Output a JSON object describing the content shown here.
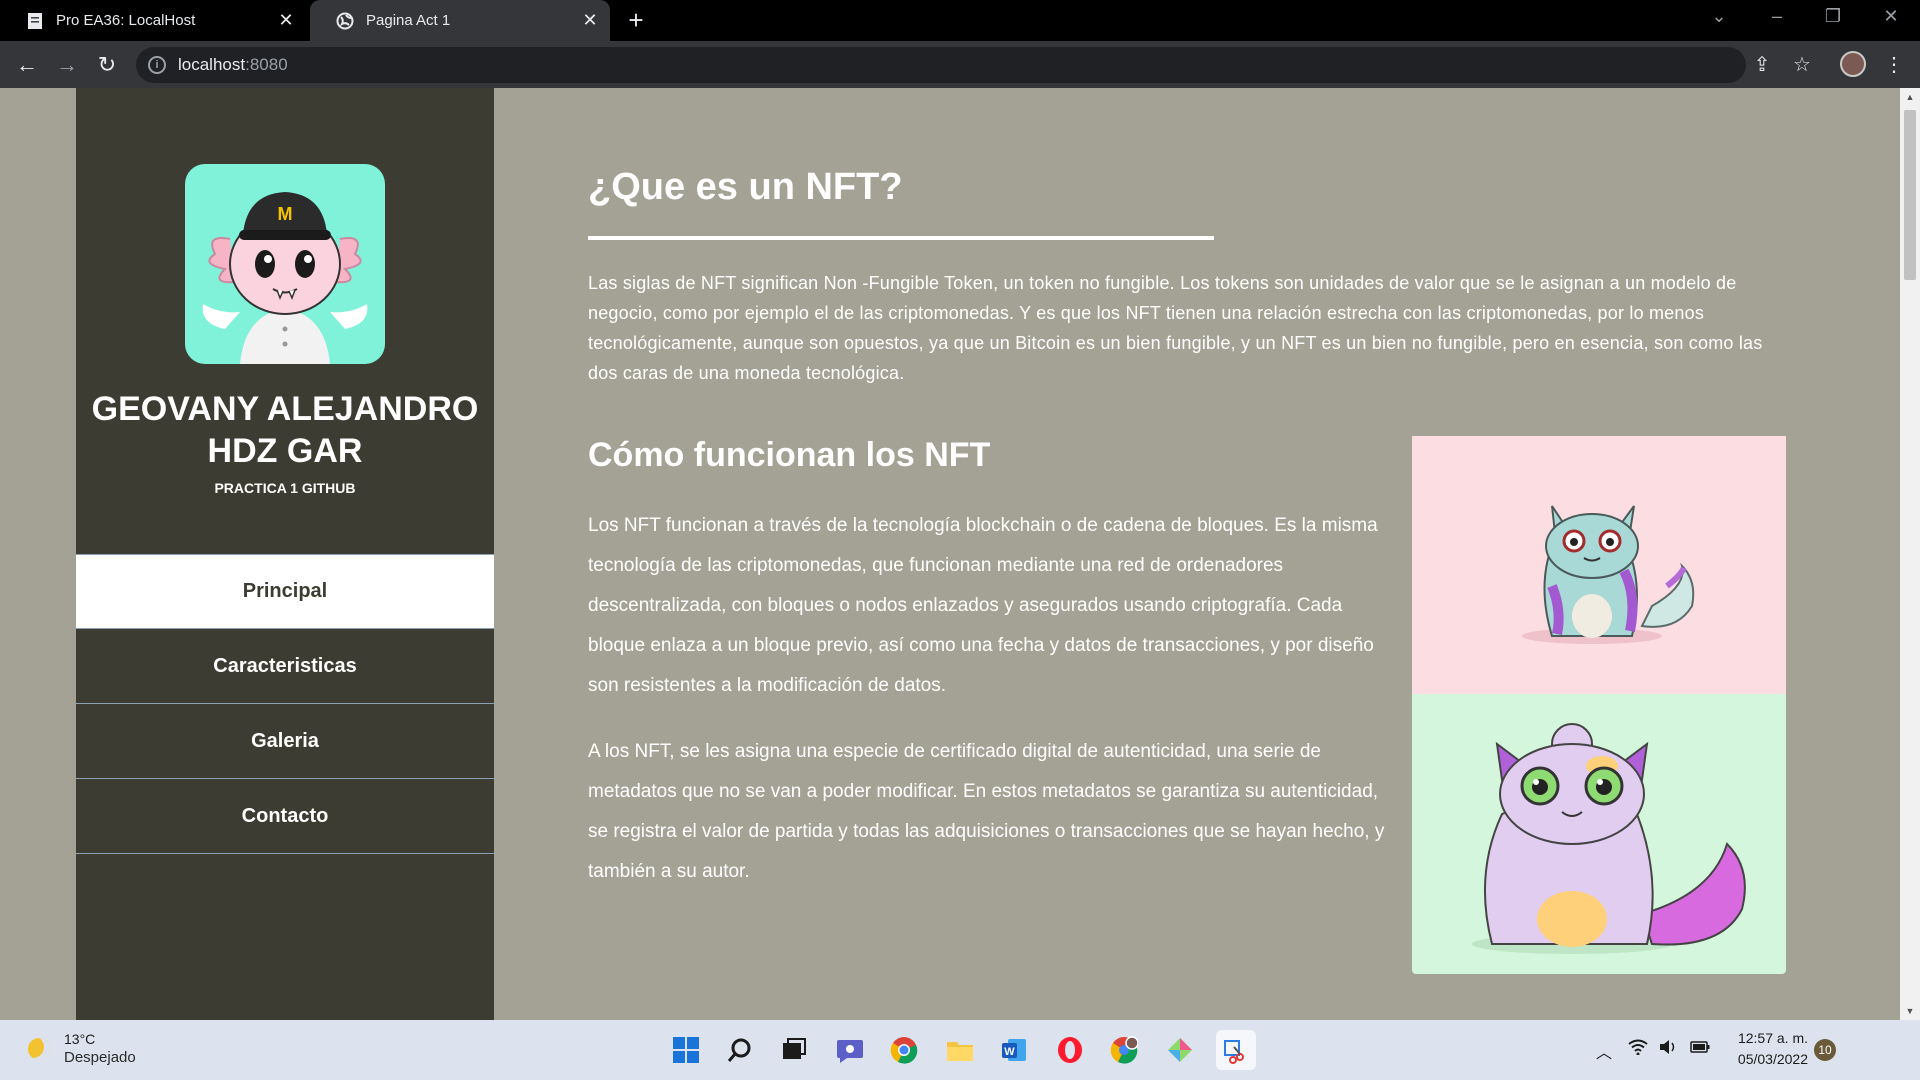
{
  "browser": {
    "tabs": [
      {
        "title": "Pro EA36: LocalHost",
        "icon": "document-icon"
      },
      {
        "title": "Pagina Act 1",
        "icon": "globe-icon"
      }
    ],
    "url_host": "localhost",
    "url_port": ":8080"
  },
  "sidebar": {
    "name": "GEOVANY ALEJANDRO HDZ GAR",
    "subtitle": "PRACTICA 1 GITHUB",
    "nav": [
      {
        "label": "Principal",
        "active": true
      },
      {
        "label": "Caracteristicas",
        "active": false
      },
      {
        "label": "Galeria",
        "active": false
      },
      {
        "label": "Contacto",
        "active": false
      }
    ]
  },
  "main": {
    "title": "¿Que es un NFT?",
    "intro": "Las siglas de NFT significan Non -Fungible Token, un token no fungible. Los tokens son unidades de valor que se le asignan a un modelo de negocio, como por ejemplo el de las criptomonedas.  Y es que los NFT tienen una relación estrecha con las criptomonedas, por lo menos tecnológicamente, aunque son opuestos, ya que un Bitcoin es un bien fungible, y un NFT es un bien no fungible, pero en esencia, son como las dos caras de una moneda tecnológica.",
    "section_title": "Cómo funcionan los NFT",
    "para1": "Los NFT funcionan a través de la tecnología blockchain o de cadena de bloques. Es la misma tecnología de las criptomonedas, que funcionan mediante una red de ordenadores descentralizada, con bloques o nodos enlazados y asegurados usando criptografía. Cada bloque enlaza a un bloque previo, así como una fecha y datos de transacciones, y por diseño son resistentes a la modificación de datos.",
    "para2": "A los NFT, se les asigna una especie de certificado digital de autenticidad, una serie de metadatos que no se van a poder modificar. En estos metadatos se garantiza su autenticidad, se registra el valor de partida y todas las adquisiciones o transacciones que se hayan hecho, y también a su autor."
  },
  "taskbar": {
    "temperature": "13°C",
    "condition": "Despejado",
    "time": "12:57 a. m.",
    "date": "05/03/2022",
    "notifications": "10"
  },
  "colors": {
    "page_bg": "#a3a294",
    "sidebar_bg": "#3c3c32",
    "avatar_bg": "#7ff2d9",
    "card_pink": "#fcdde2",
    "card_green": "#d4f6dc"
  }
}
